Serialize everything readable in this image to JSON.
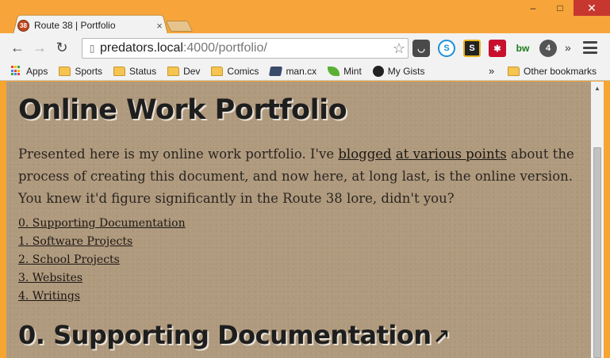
{
  "browser": {
    "tab": {
      "favicon_text": "38",
      "title": "Route 38 | Portfolio",
      "close": "×"
    },
    "window_controls": {
      "minimize": "–",
      "maximize": "□",
      "close": "✕"
    },
    "nav": {
      "back": "←",
      "forward": "→",
      "reload": "↻"
    },
    "omnibox": {
      "host": "predators.local",
      "path": ":4000/portfolio/"
    },
    "extensions": [
      {
        "name": "pocket-icon",
        "glyph": "◡"
      },
      {
        "name": "skype-icon",
        "glyph": "S"
      },
      {
        "name": "s-extension-icon",
        "glyph": "S"
      },
      {
        "name": "lastpass-icon",
        "glyph": "✱"
      },
      {
        "name": "bw-extension-icon",
        "glyph": "bw"
      },
      {
        "name": "badge-extension-icon",
        "glyph": "4"
      }
    ],
    "extensions_more": "»",
    "bookmarks": [
      {
        "label": "Apps",
        "icon": "apps-grid-icon"
      },
      {
        "label": "Sports",
        "icon": "folder-icon"
      },
      {
        "label": "Status",
        "icon": "folder-icon"
      },
      {
        "label": "Dev",
        "icon": "folder-icon"
      },
      {
        "label": "Comics",
        "icon": "folder-icon"
      },
      {
        "label": "man.cx",
        "icon": "book-icon"
      },
      {
        "label": "Mint",
        "icon": "leaf-icon"
      },
      {
        "label": "My Gists",
        "icon": "github-icon"
      }
    ],
    "bookmarks_more": "»",
    "other_bookmarks": "Other bookmarks"
  },
  "page": {
    "title": "Online Work Portfolio",
    "intro": {
      "part1": "Presented here is my online work portfolio. I've ",
      "link1": "blogged",
      "part2": " ",
      "link2": "at various points",
      "part3": " about the process of creating this document, and now here, at long last, is the online version. You knew it'd figure significantly in the Route 38 lore, didn't you?"
    },
    "toc": [
      "0. Supporting Documentation",
      "1. Software Projects",
      "2. School Projects",
      "3. Websites",
      "4. Writings"
    ],
    "section_heading": "0. Supporting Documentation",
    "section_arrow": "↗"
  },
  "colors": {
    "chrome_frame": "#f5a530",
    "paper": "#b09a7e",
    "text": "#1e1e1e"
  }
}
